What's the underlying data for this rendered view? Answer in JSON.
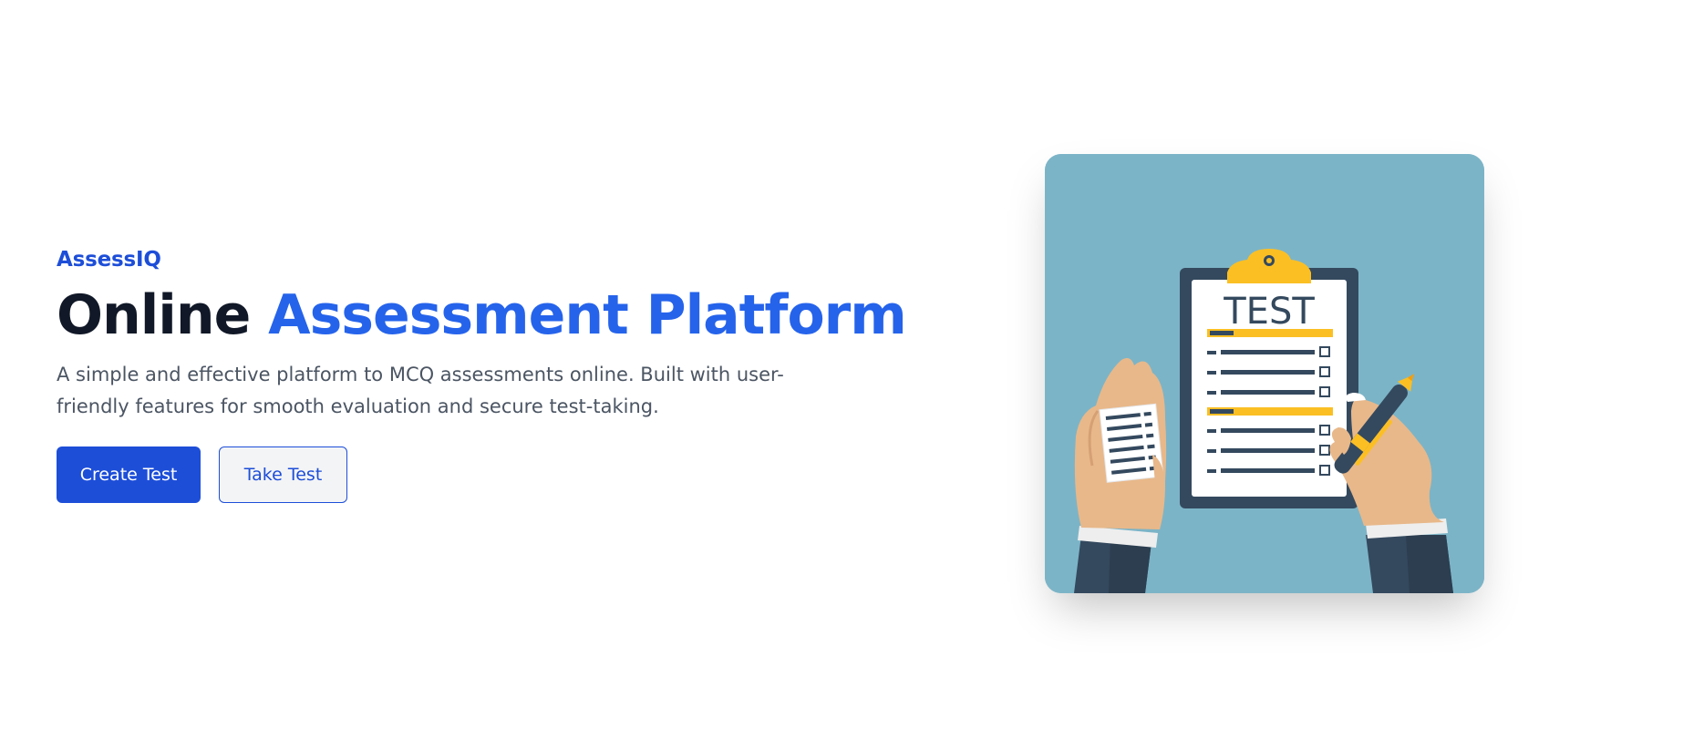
{
  "hero": {
    "brand": "AssessIQ",
    "headline_plain": "Online ",
    "headline_accent": "Assessment Platform",
    "tagline": "A simple and effective platform to MCQ assessments online. Built with user-friendly features for smooth evaluation and secure test-taking.",
    "primary_button": "Create Test",
    "secondary_button": "Take Test"
  },
  "illustration": {
    "clipboard_title": "TEST"
  },
  "colors": {
    "brand": "#1d4ed8",
    "accent": "#2563eb",
    "heading": "#111827",
    "body_text": "#4b5563",
    "illustration_background": "#7cb4c7",
    "clipboard": "#34495e",
    "highlight": "#fbbf24"
  }
}
